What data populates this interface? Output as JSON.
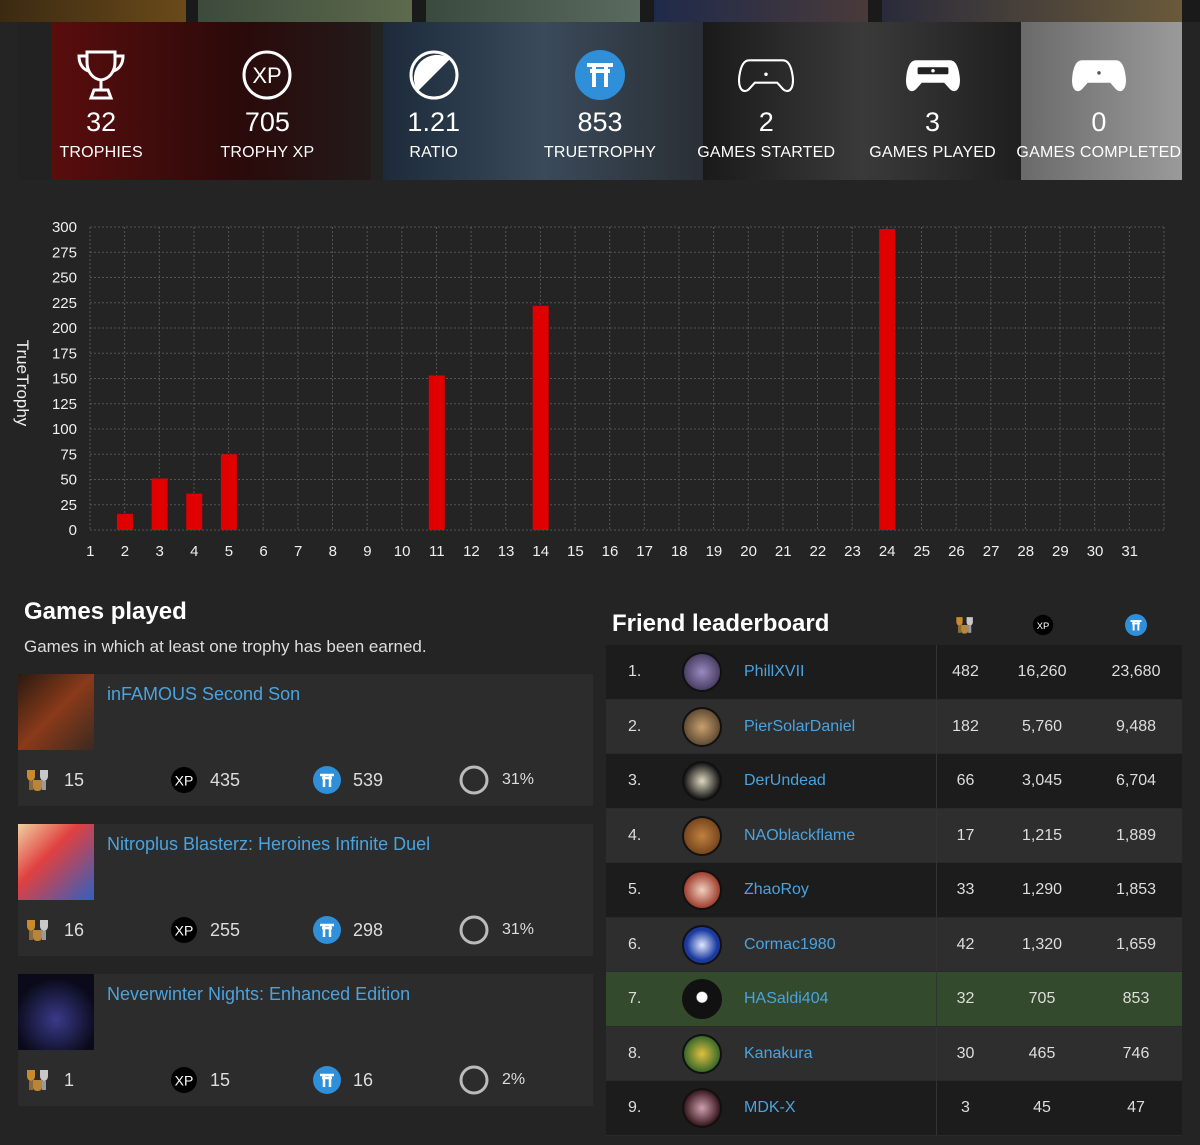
{
  "stats": [
    {
      "icon": "trophy-icon",
      "value": "32",
      "label": "TROPHIES"
    },
    {
      "icon": "xp-icon",
      "value": "705",
      "label": "TROPHY XP"
    },
    {
      "icon": "ratio-icon",
      "value": "1.21",
      "label": "RATIO"
    },
    {
      "icon": "truetrophy-icon",
      "value": "853",
      "label": "TRUETROPHY"
    },
    {
      "icon": "controller-outline-icon",
      "value": "2",
      "label": "GAMES STARTED"
    },
    {
      "icon": "controller-half-icon",
      "value": "3",
      "label": "GAMES PLAYED"
    },
    {
      "icon": "controller-solid-icon",
      "value": "0",
      "label": "GAMES COMPLETED"
    }
  ],
  "chart_data": {
    "type": "bar",
    "categories": [
      "1",
      "2",
      "3",
      "4",
      "5",
      "6",
      "7",
      "8",
      "9",
      "10",
      "11",
      "12",
      "13",
      "14",
      "15",
      "16",
      "17",
      "18",
      "19",
      "20",
      "21",
      "22",
      "23",
      "24",
      "25",
      "26",
      "27",
      "28",
      "29",
      "30",
      "31"
    ],
    "values": [
      0,
      16,
      51,
      36,
      75,
      0,
      0,
      0,
      0,
      0,
      153,
      0,
      0,
      222,
      0,
      0,
      0,
      0,
      0,
      0,
      0,
      0,
      0,
      298,
      0,
      0,
      0,
      0,
      0,
      0,
      0
    ],
    "ylabel": "TrueTrophy",
    "ylim": [
      0,
      300
    ],
    "yticks": [
      "300",
      "275",
      "250",
      "225",
      "200",
      "175",
      "150",
      "125",
      "100",
      "75",
      "50",
      "25",
      "0"
    ],
    "bar_color": "#e00000",
    "grid": true
  },
  "games_played": {
    "title": "Games played",
    "subtitle": "Games in which at least one trophy has been earned.",
    "items": [
      {
        "title": "inFAMOUS Second Son",
        "trophies": "15",
        "xp_badge": "XP",
        "xp": "435",
        "truetrophy": "539",
        "progress": "31%",
        "progress_value": 31
      },
      {
        "title": "Nitroplus Blasterz: Heroines Infinite Duel",
        "trophies": "16",
        "xp_badge": "XP",
        "xp": "255",
        "truetrophy": "298",
        "progress": "31%",
        "progress_value": 31
      },
      {
        "title": "Neverwinter Nights: Enhanced Edition",
        "trophies": "1",
        "xp_badge": "XP",
        "xp": "15",
        "truetrophy": "16",
        "progress": "2%",
        "progress_value": 2
      }
    ]
  },
  "leaderboard": {
    "title": "Friend leaderboard",
    "xp_badge": "XP",
    "rows": [
      {
        "rank": "1.",
        "name": "PhillXVII",
        "trophies": "482",
        "xp": "16,260",
        "truetrophy": "23,680"
      },
      {
        "rank": "2.",
        "name": "PierSolarDaniel",
        "trophies": "182",
        "xp": "5,760",
        "truetrophy": "9,488"
      },
      {
        "rank": "3.",
        "name": "DerUndead",
        "trophies": "66",
        "xp": "3,045",
        "truetrophy": "6,704"
      },
      {
        "rank": "4.",
        "name": "NAOblackflame",
        "trophies": "17",
        "xp": "1,215",
        "truetrophy": "1,889"
      },
      {
        "rank": "5.",
        "name": "ZhaoRoy",
        "trophies": "33",
        "xp": "1,290",
        "truetrophy": "1,853"
      },
      {
        "rank": "6.",
        "name": "Cormac1980",
        "trophies": "42",
        "xp": "1,320",
        "truetrophy": "1,659"
      },
      {
        "rank": "7.",
        "name": "HASaldi404",
        "trophies": "32",
        "xp": "705",
        "truetrophy": "853",
        "highlight": true
      },
      {
        "rank": "8.",
        "name": "Kanakura",
        "trophies": "30",
        "xp": "465",
        "truetrophy": "746"
      },
      {
        "rank": "9.",
        "name": "MDK-X",
        "trophies": "3",
        "xp": "45",
        "truetrophy": "47"
      }
    ]
  },
  "colors": {
    "accent_link": "#4aa3df",
    "bar": "#e00000",
    "highlight_row": "#344a2c",
    "truetrophy_badge": "#2f8fd8"
  }
}
